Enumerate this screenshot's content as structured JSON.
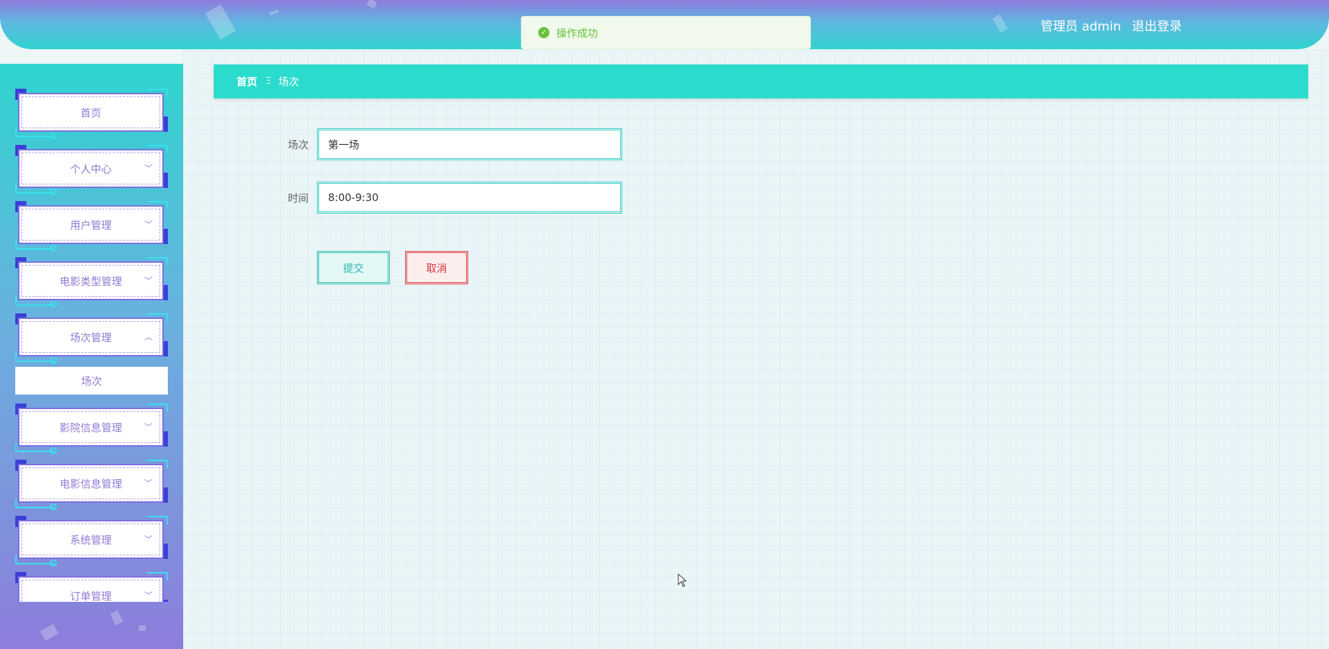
{
  "header": {
    "user_label": "管理员 admin",
    "logout_label": "退出登录"
  },
  "toast": {
    "message": "操作成功"
  },
  "sidebar": {
    "items": [
      {
        "label": "首页",
        "expandable": false
      },
      {
        "label": "个人中心",
        "expandable": true,
        "expanded": false
      },
      {
        "label": "用户管理",
        "expandable": true,
        "expanded": false
      },
      {
        "label": "电影类型管理",
        "expandable": true,
        "expanded": false
      },
      {
        "label": "场次管理",
        "expandable": true,
        "expanded": true,
        "children": [
          "场次"
        ]
      },
      {
        "label": "影院信息管理",
        "expandable": true,
        "expanded": false
      },
      {
        "label": "电影信息管理",
        "expandable": true,
        "expanded": false
      },
      {
        "label": "系统管理",
        "expandable": true,
        "expanded": false
      },
      {
        "label": "订单管理",
        "expandable": true,
        "expanded": false
      }
    ]
  },
  "breadcrumb": {
    "home": "首页",
    "separator": "Ξ",
    "current": "场次"
  },
  "form": {
    "fields": [
      {
        "label": "场次",
        "value": "第一场"
      },
      {
        "label": "时间",
        "value": "8:00-9:30"
      }
    ],
    "submit_label": "提交",
    "cancel_label": "取消"
  },
  "colors": {
    "accent": "#2bdbcd",
    "menu_text": "#8e7ad6",
    "success": "#67c23a",
    "danger": "#d6373e"
  }
}
